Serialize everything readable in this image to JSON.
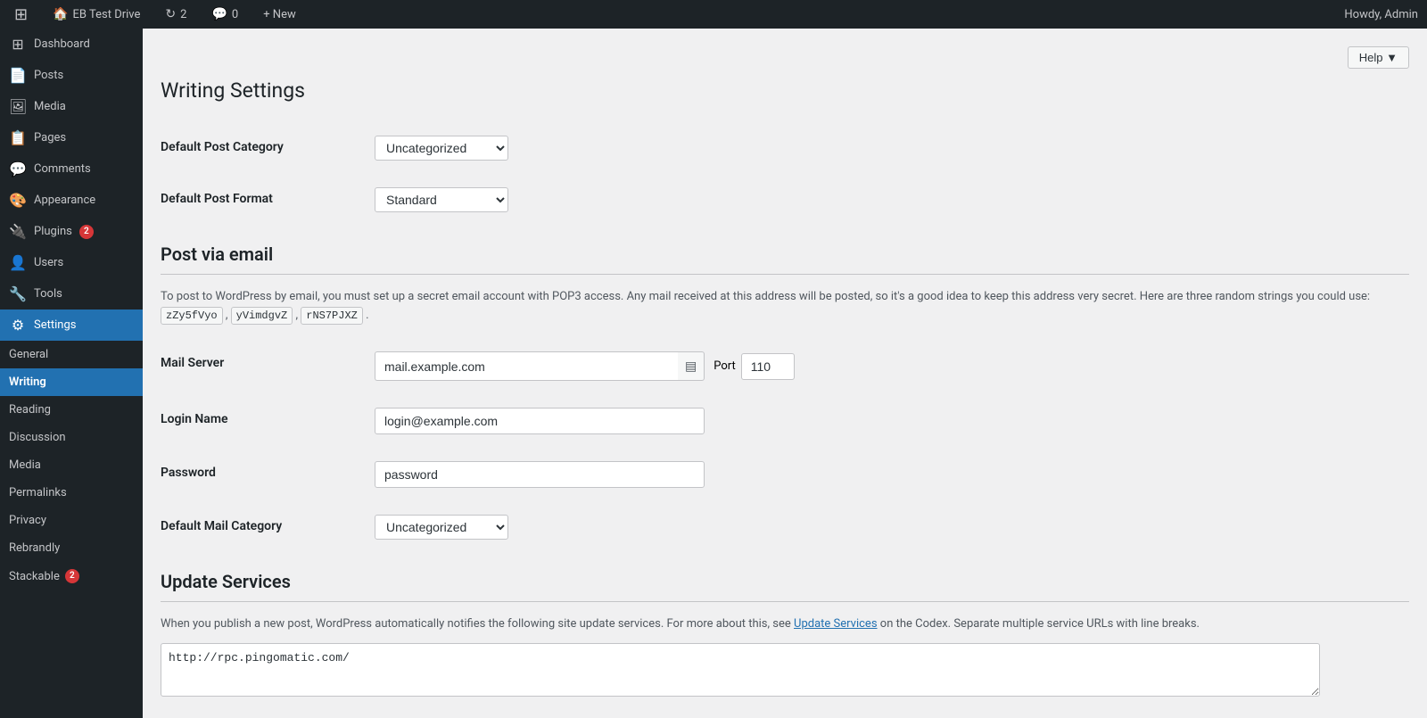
{
  "adminbar": {
    "site_name": "EB Test Drive",
    "updates_count": "2",
    "comments_count": "0",
    "new_label": "+ New",
    "howdy": "Howdy, Admin",
    "help_label": "Help ▼"
  },
  "sidebar": {
    "items": [
      {
        "id": "dashboard",
        "label": "Dashboard",
        "icon": "⊞"
      },
      {
        "id": "posts",
        "label": "Posts",
        "icon": "📄"
      },
      {
        "id": "media",
        "label": "Media",
        "icon": "🖼"
      },
      {
        "id": "pages",
        "label": "Pages",
        "icon": "📋"
      },
      {
        "id": "comments",
        "label": "Comments",
        "icon": "💬"
      },
      {
        "id": "appearance",
        "label": "Appearance",
        "icon": "🎨"
      },
      {
        "id": "plugins",
        "label": "Plugins",
        "icon": "🔌",
        "badge": "2"
      },
      {
        "id": "users",
        "label": "Users",
        "icon": "👤"
      },
      {
        "id": "tools",
        "label": "Tools",
        "icon": "🔧"
      },
      {
        "id": "settings",
        "label": "Settings",
        "icon": "⚙",
        "active": true
      }
    ],
    "submenu": [
      {
        "id": "general",
        "label": "General"
      },
      {
        "id": "writing",
        "label": "Writing",
        "active": true
      },
      {
        "id": "reading",
        "label": "Reading"
      },
      {
        "id": "discussion",
        "label": "Discussion"
      },
      {
        "id": "media",
        "label": "Media"
      },
      {
        "id": "permalinks",
        "label": "Permalinks"
      },
      {
        "id": "privacy",
        "label": "Privacy"
      },
      {
        "id": "rebrandly",
        "label": "Rebrandly"
      },
      {
        "id": "stackable",
        "label": "Stackable",
        "badge": "2"
      }
    ]
  },
  "page": {
    "title": "Writing Settings",
    "help_btn": "Help ▼"
  },
  "form": {
    "default_post_category_label": "Default Post Category",
    "default_post_category_value": "Uncategorized",
    "default_post_format_label": "Default Post Format",
    "default_post_format_value": "Standard",
    "post_via_email_title": "Post via email",
    "post_via_email_desc1": "To post to WordPress by email, you must set up a secret email account with POP3 access. Any mail received at this address will be posted, so it's a good idea to keep this address very secret. Here are three random strings you could use:",
    "random_string_1": "zZy5fVyo",
    "random_string_2": "yVimdgvZ",
    "random_string_3": "rNS7PJXZ",
    "mail_server_label": "Mail Server",
    "mail_server_value": "mail.example.com",
    "port_label": "Port",
    "port_value": "110",
    "login_name_label": "Login Name",
    "login_name_value": "login@example.com",
    "password_label": "Password",
    "password_value": "password",
    "default_mail_category_label": "Default Mail Category",
    "default_mail_category_value": "Uncategorized",
    "update_services_title": "Update Services",
    "update_services_desc": "When you publish a new post, WordPress automatically notifies the following site update services. For more about this, see",
    "update_services_link_text": "Update Services",
    "update_services_desc2": "on the Codex. Separate multiple service URLs with line breaks.",
    "update_services_value": "http://rpc.pingomatic.com/"
  }
}
